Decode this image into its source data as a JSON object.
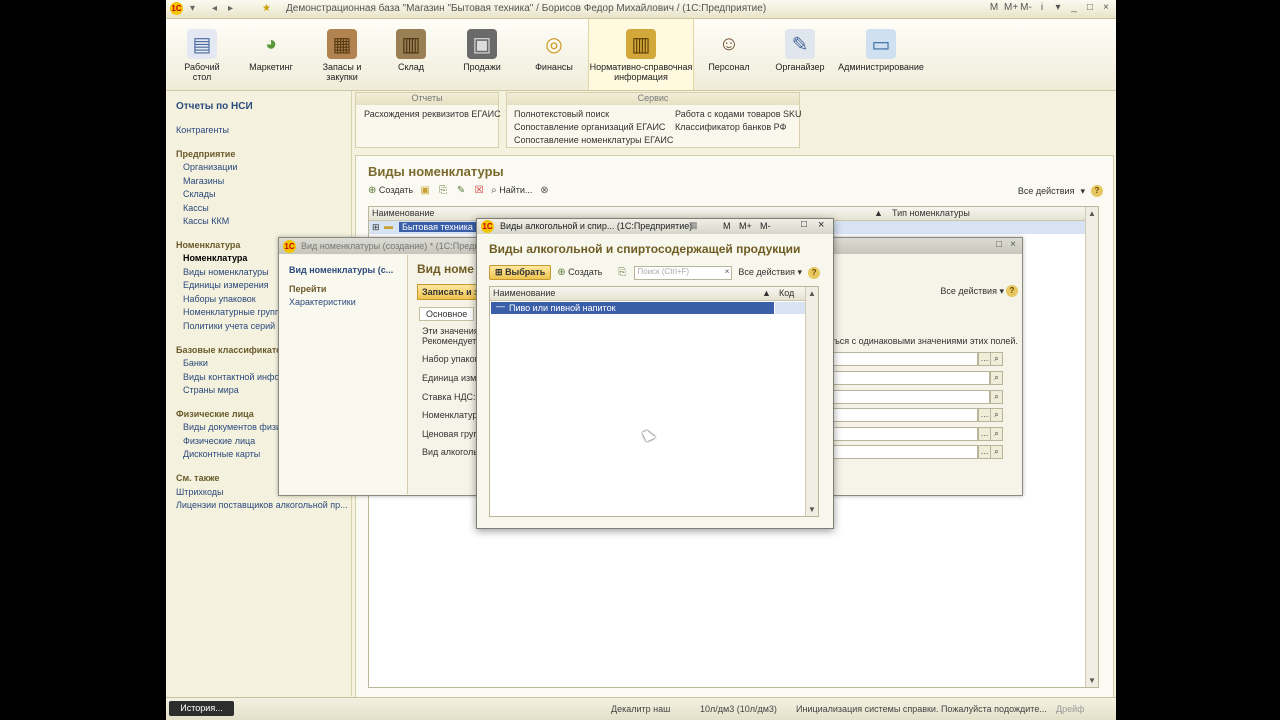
{
  "window": {
    "title": "Демонстрационная база \"Магазин \"Бытовая техника\" / Борисов Федор Михайлович / (1С:Предприятие)",
    "right_icons": [
      "M",
      "M+",
      "M-",
      "i",
      "▾",
      "_",
      "□",
      "×"
    ]
  },
  "sections": [
    {
      "label": "Рабочий стол"
    },
    {
      "label": "Маркетинг"
    },
    {
      "label": "Запасы и закупки"
    },
    {
      "label": "Склад"
    },
    {
      "label": "Продажи"
    },
    {
      "label": "Финансы"
    },
    {
      "label": "Нормативно-справочная информация"
    },
    {
      "label": "Персонал"
    },
    {
      "label": "Органайзер"
    },
    {
      "label": "Администрирование"
    }
  ],
  "leftnav": {
    "reports": "Отчеты по НСИ",
    "counterparties": "Контрагенты",
    "enterprise": "Предприятие",
    "organizations": "Организации",
    "shops": "Магазины",
    "warehouses": "Склады",
    "cashboxes": "Кассы",
    "kkm": "Кассы ККМ",
    "nomenclature_group": "Номенклатура",
    "nomenclature": "Номенклатура",
    "nom_types": "Виды номенклатуры",
    "units": "Единицы измерения",
    "packs": "Наборы упаковок",
    "nom_groups": "Номенклатурные группы",
    "serial_policies": "Политики учета серий",
    "base_class": "Базовые классификаторы",
    "banks": "Банки",
    "contact_types": "Виды контактной информации",
    "countries": "Страны мира",
    "persons_group": "Физические лица",
    "doc_types": "Виды документов физических лиц",
    "persons": "Физические лица",
    "discount_cards": "Дисконтные карты",
    "see_also": "См. также",
    "barcodes": "Штрихкоды",
    "licenses": "Лицензии поставщиков алкогольной пр..."
  },
  "cmd": {
    "reports_title": "Отчеты",
    "reports_item": "Расхождения реквизитов ЕГАИС",
    "service_title": "Сервис",
    "service_items": [
      "Полнотекстовый поиск",
      "Сопоставление организаций ЕГАИС",
      "Сопоставление номенклатуры ЕГАИС"
    ],
    "service_items2": [
      "Работа с кодами товаров SKU",
      "Классификатор банков РФ"
    ]
  },
  "mainform": {
    "title": "Виды номенклатуры",
    "create": "Создать",
    "find": "Найти...",
    "all_actions": "Все действия",
    "col_name": "Наименование",
    "col_type": "Тип номенклатуры",
    "row1": "Бытовая техника"
  },
  "win2": {
    "title": "Вид номенклатуры (создание) * (1С:Предприятие)",
    "side_title": "Вид номенклатуры (с...",
    "goto": "Перейти",
    "characteristics": "Характеристики",
    "form_title": "Вид номе",
    "save_button": "Записать и з",
    "tab_main": "Основное",
    "all_actions": "Все действия",
    "hint1": "Эти значения",
    "hint2": "Рекомендуетс",
    "hint_right": "ться с одинаковыми значениями этих полей.",
    "labels": [
      "Набор упаков",
      "Единица изме",
      "Ставка НДС:",
      "Номенклатурн",
      "Ценовая групп",
      "Вид алкоголь"
    ]
  },
  "dialog": {
    "title": "Виды алкогольной и спир... (1С:Предприятие)",
    "heading": "Виды алкогольной и спиртосодержащей продукции",
    "select": "Выбрать",
    "create": "Создать",
    "search_placeholder": "Поиск (Ctrl+F)",
    "all_actions": "Все действия",
    "col_name": "Наименование",
    "col_code": "Код",
    "row1": "Пиво или пивной напиток",
    "title_icons": [
      "M",
      "M+",
      "M-"
    ]
  },
  "statusbar": {
    "history": "История...",
    "item1": "Декалитр наш",
    "item2": "10л/дм3 (10л/дм3)",
    "item3": "Инициализация системы справки. Пожалуйста подождите...",
    "item4": "Дрейф"
  }
}
